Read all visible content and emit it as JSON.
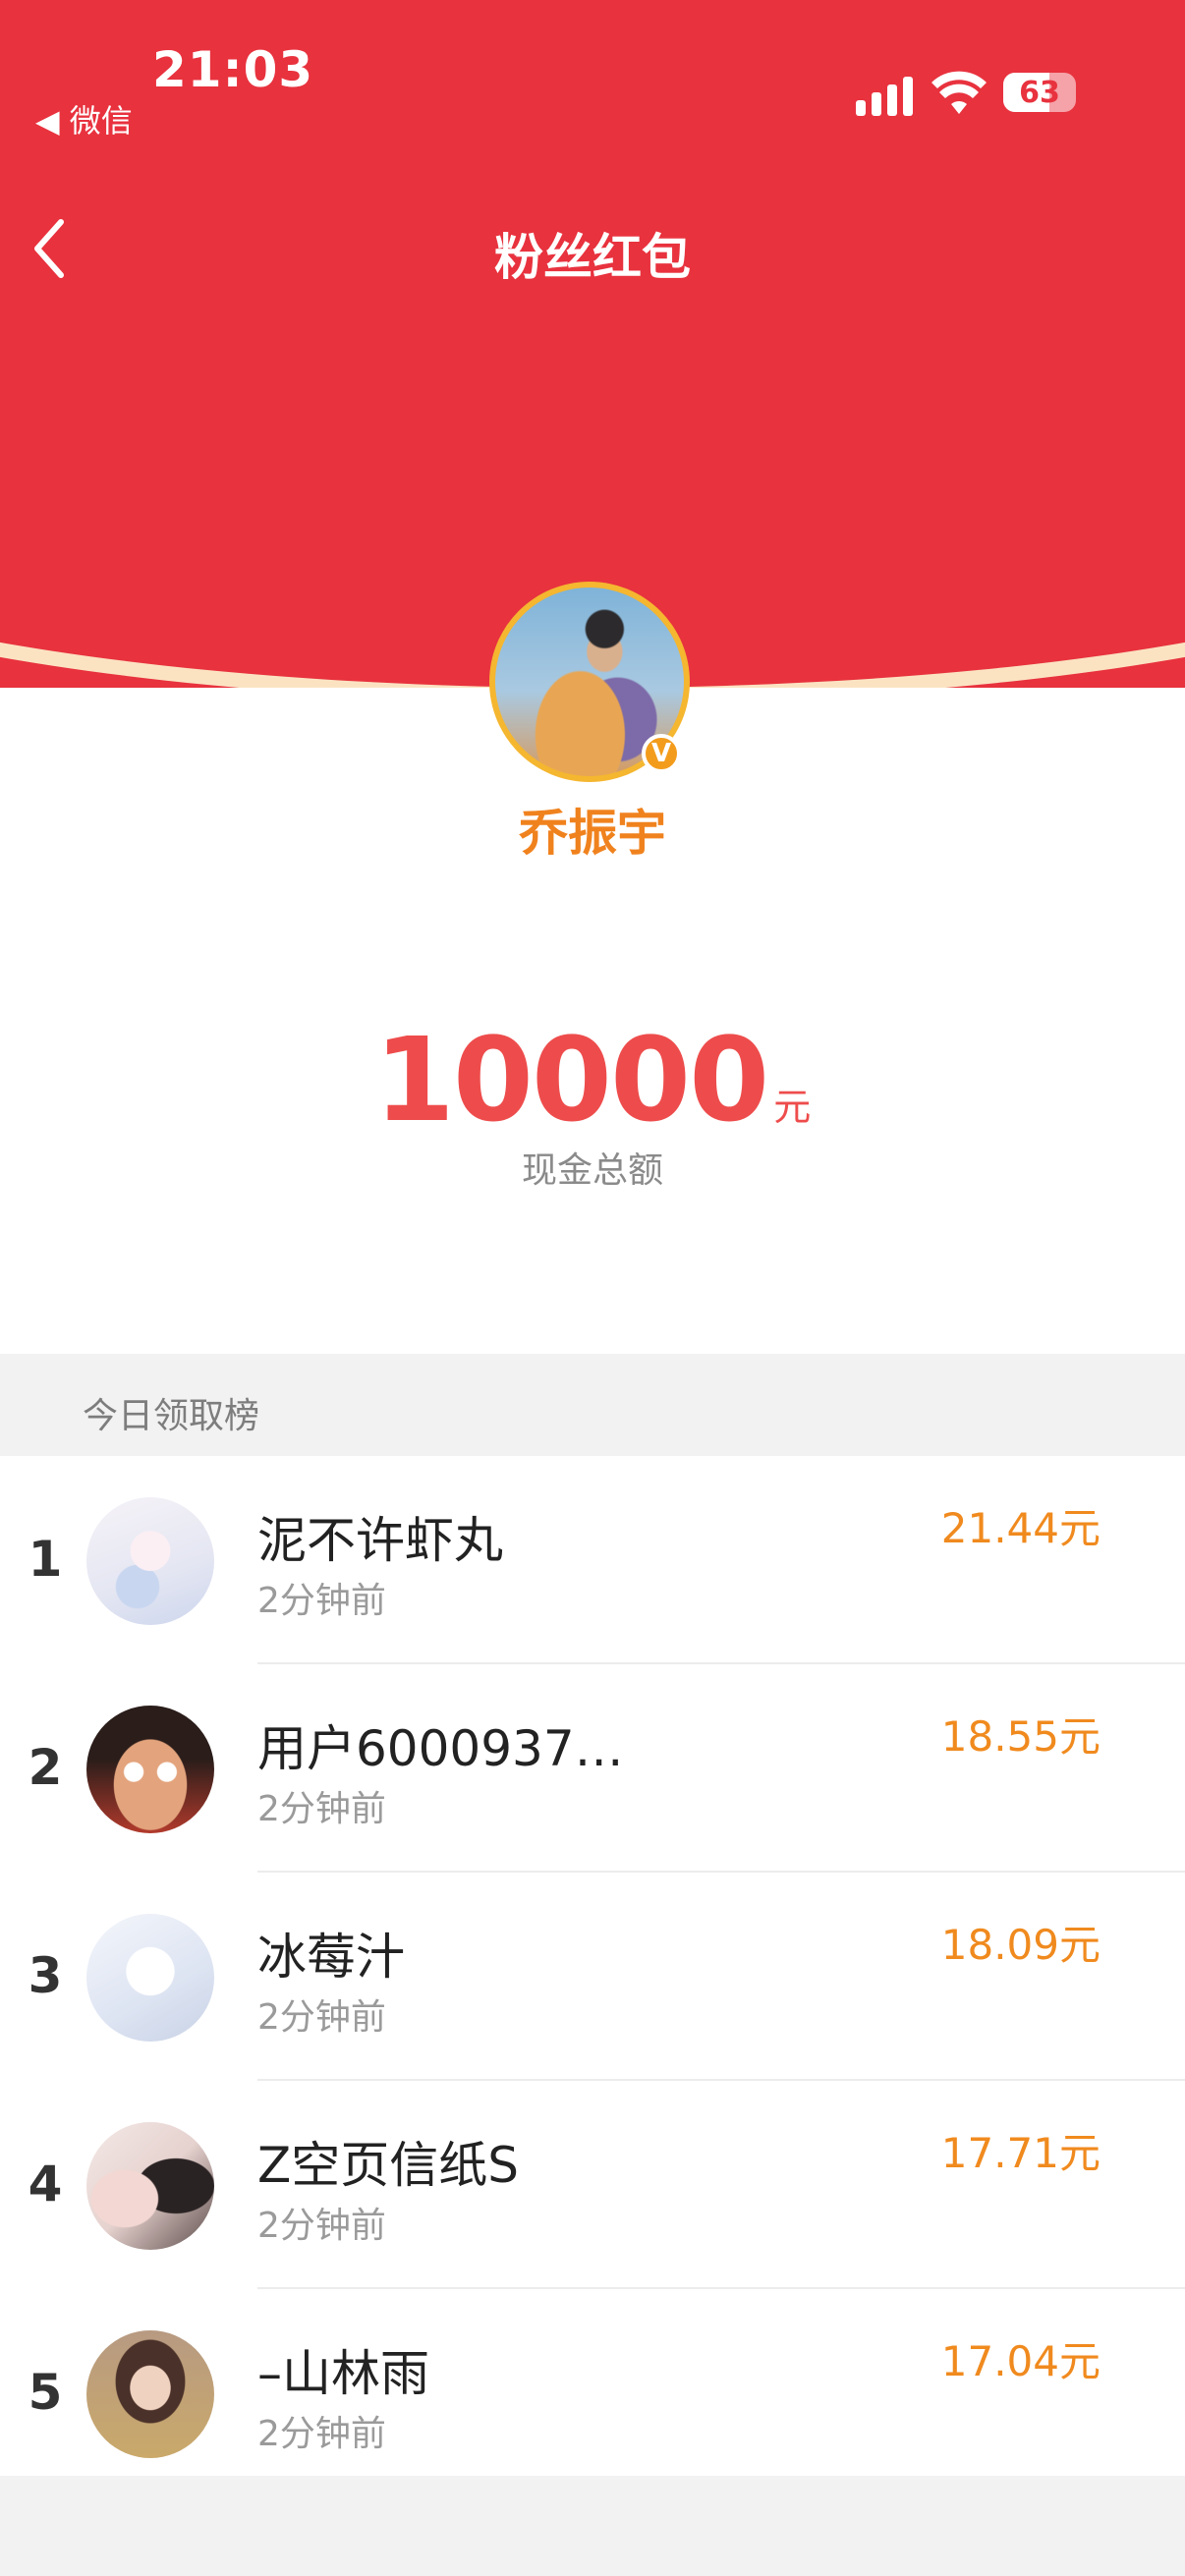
{
  "status_bar": {
    "time": "21:03",
    "back_app": "◀ 微信",
    "battery": "63",
    "battery_level": 0.63
  },
  "nav": {
    "back_icon": "chevron-left-icon",
    "title": "粉丝红包"
  },
  "host": {
    "name": "乔振宇",
    "verified_badge": "V"
  },
  "amount": {
    "value": "10000",
    "unit": "元",
    "label": "现金总额"
  },
  "leaderboard": {
    "title": "今日领取榜",
    "rows": [
      {
        "rank": "1",
        "name": "泥不许虾丸",
        "time": "2分钟前",
        "amount": "21.44元"
      },
      {
        "rank": "2",
        "name": "用户6000937…",
        "time": "2分钟前",
        "amount": "18.55元"
      },
      {
        "rank": "3",
        "name": "冰莓汁",
        "time": "2分钟前",
        "amount": "18.09元"
      },
      {
        "rank": "4",
        "name": "Z空页信纸S",
        "time": "2分钟前",
        "amount": "17.71元"
      },
      {
        "rank": "5",
        "name": "–山林雨",
        "time": "2分钟前",
        "amount": "17.04元"
      }
    ]
  },
  "colors": {
    "header_red": "#e8323e",
    "arc_cream": "#fbe3c2",
    "amount_red": "#ee4c4c",
    "accent_orange": "#f08a1e",
    "avatar_ring": "#f5b630"
  }
}
